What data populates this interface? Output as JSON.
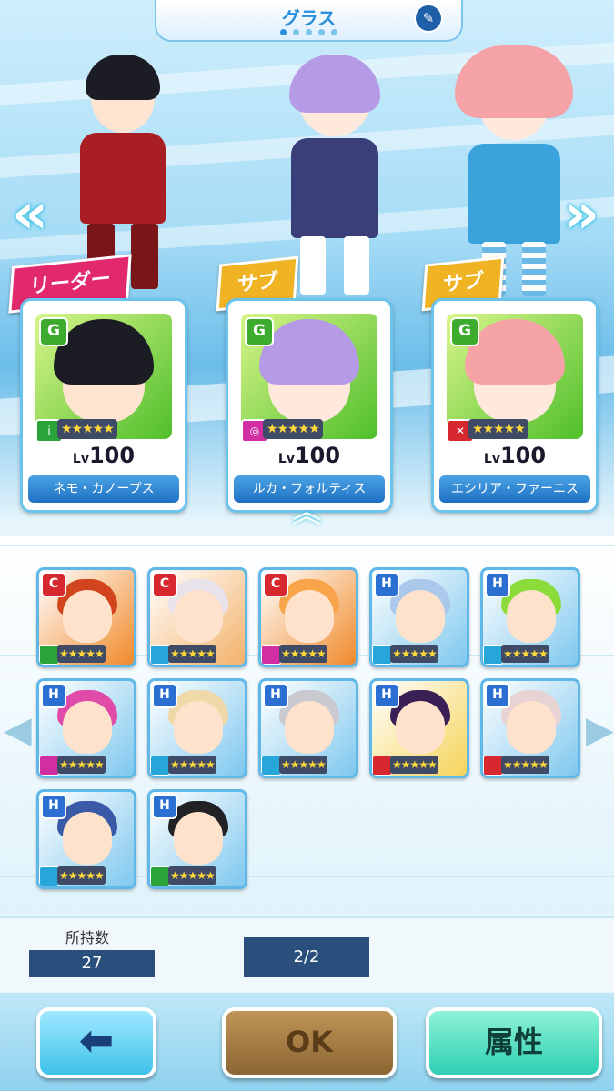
{
  "header": {
    "title": "グラス",
    "page_dots": 5,
    "active_dot": 0
  },
  "team": [
    {
      "role": "リーダー",
      "rank": "G",
      "stars": "★★★★★",
      "level_prefix": "Lv",
      "level": "100",
      "name": "ネモ・カノープス",
      "elem_color": "#2aa33b",
      "hair_color": "#1c1c24",
      "bg": "#4fbf2b",
      "tag_color": "#e2296e"
    },
    {
      "role": "サブ",
      "rank": "G",
      "stars": "★★★★★",
      "level_prefix": "Lv",
      "level": "100",
      "name": "ルカ・フォルティス",
      "elem_color": "#d22ea4",
      "hair_color": "#b59be6",
      "bg": "#4fbf2b",
      "tag_color": "#f0b323"
    },
    {
      "role": "サブ",
      "rank": "G",
      "stars": "★★★★★",
      "level_prefix": "Lv",
      "level": "100",
      "name": "エシリア・ファーニス",
      "elem_color": "#d8282f",
      "hair_color": "#f5a3a7",
      "bg": "#4fbf2b",
      "tag_color": "#f0b323"
    }
  ],
  "roster": [
    {
      "rank": "C",
      "stars": "★★★★★",
      "elem_color": "#2aa33b",
      "hair": "#d2441e",
      "bg": "#f08a2a"
    },
    {
      "rank": "C",
      "stars": "★★★★★",
      "elem_color": "#27a6d9",
      "hair": "#e8e3ea",
      "bg": "#f3b26a"
    },
    {
      "rank": "C",
      "stars": "★★★★★",
      "elem_color": "#d22ea4",
      "hair": "#f7a44b",
      "bg": "#f08a2a"
    },
    {
      "rank": "H",
      "stars": "★★★★★",
      "elem_color": "#27a6d9",
      "hair": "#a9c8ea",
      "bg": "#7fc8ee"
    },
    {
      "rank": "H",
      "stars": "★★★★★",
      "elem_color": "#27a6d9",
      "hair": "#8bdc3a",
      "bg": "#7fc8ee"
    },
    {
      "rank": "H",
      "stars": "★★★★★",
      "elem_color": "#d22ea4",
      "hair": "#e04aa8",
      "bg": "#7fc8ee"
    },
    {
      "rank": "H",
      "stars": "★★★★★",
      "elem_color": "#27a6d9",
      "hair": "#f0d9a8",
      "bg": "#7fc8ee"
    },
    {
      "rank": "H",
      "stars": "★★★★★",
      "elem_color": "#27a6d9",
      "hair": "#c9c9cf",
      "bg": "#7fc8ee"
    },
    {
      "rank": "H",
      "stars": "★★★★★",
      "elem_color": "#d8282f",
      "hair": "#3a2055",
      "bg": "#f5d45a"
    },
    {
      "rank": "H",
      "stars": "★★★★★",
      "elem_color": "#d8282f",
      "hair": "#e7d3d3",
      "bg": "#7fc8ee"
    },
    {
      "rank": "H",
      "stars": "★★★★★",
      "elem_color": "#27a6d9",
      "hair": "#3a5aa8",
      "bg": "#7fc8ee"
    },
    {
      "rank": "H",
      "stars": "★★★★★",
      "elem_color": "#2aa33b",
      "hair": "#222226",
      "bg": "#7fc8ee"
    }
  ],
  "counter": {
    "owned_label": "所持数",
    "owned_value": "27",
    "page": "2/2"
  },
  "buttons": {
    "back_icon": "left-arrow-icon",
    "ok": "OK",
    "attribute": "属性"
  },
  "colors": {
    "accent": "#2a8ed9",
    "frame": "#6bc4ee",
    "name_bar": "#1f70c4"
  }
}
